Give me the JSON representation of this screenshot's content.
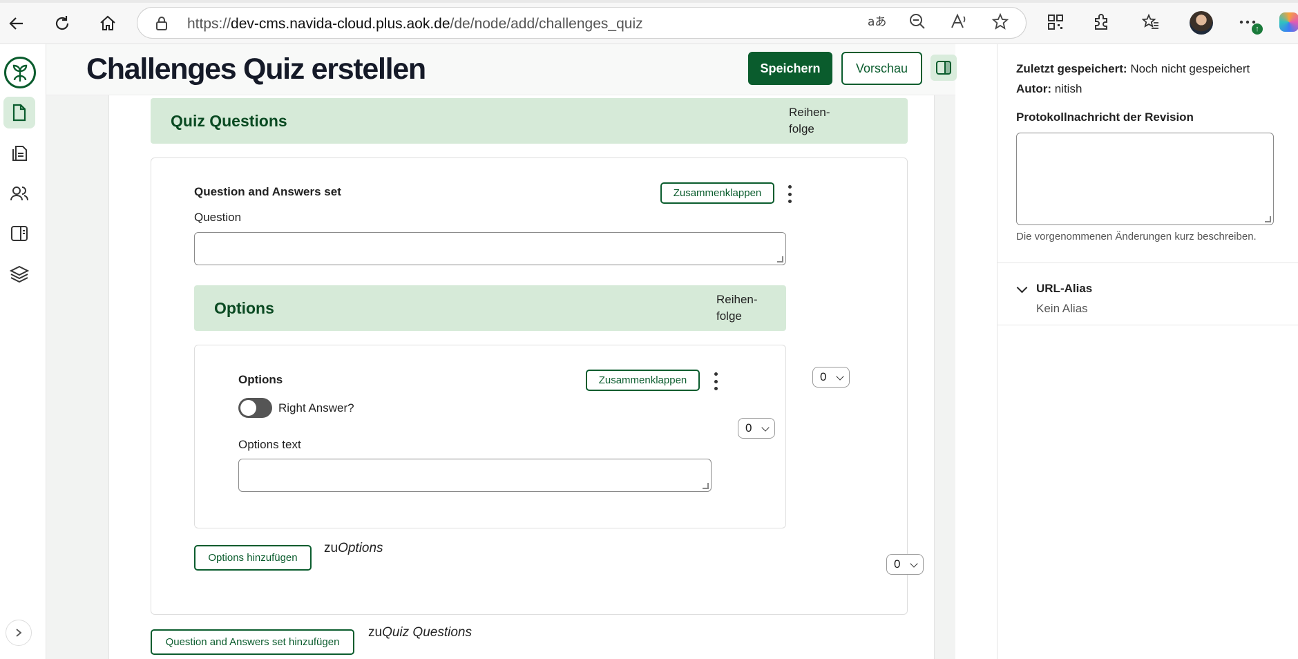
{
  "browser": {
    "url_prefix": "https://",
    "url_host": "dev-cms.navida-cloud.plus.aok.de",
    "url_path": "/de/node/add/challenges_quiz"
  },
  "header": {
    "title": "Challenges Quiz erstellen",
    "save_label": "Speichern",
    "preview_label": "Vorschau"
  },
  "quiz_questions": {
    "title": "Quiz Questions",
    "order_label": "Reihen-\nfolge",
    "item": {
      "title": "Question and Answers set",
      "collapse_label": "Zusammenklappen",
      "question_label": "Question",
      "weight": "0",
      "options": {
        "title": "Options",
        "order_label": "Reihen-\nfolge",
        "item": {
          "title": "Options",
          "collapse_label": "Zusammenklappen",
          "right_answer_label": "Right Answer?",
          "right_answer_checked": false,
          "text_label": "Options text",
          "weight": "0"
        },
        "add_label": "Options hinzufügen",
        "add_suffix_prefix": "zu",
        "add_suffix_target": "Options",
        "outer_weight": "0"
      }
    },
    "add_label": "Question and Answers set hinzufügen",
    "add_suffix_prefix": "zu",
    "add_suffix_target": "Quiz Questions"
  },
  "meta": {
    "last_saved_label": "Zuletzt gespeichert:",
    "last_saved_value": "Noch nicht gespeichert",
    "author_label": "Autor:",
    "author_value": "nitish",
    "revision_label": "Protokollnachricht der Revision",
    "revision_hint": "Die vorgenommenen Änderungen kurz beschreiben.",
    "alias_title": "URL-Alias",
    "alias_value": "Kein Alias"
  },
  "colors": {
    "brand": "#0a5c2d",
    "band": "#d6ead8"
  }
}
